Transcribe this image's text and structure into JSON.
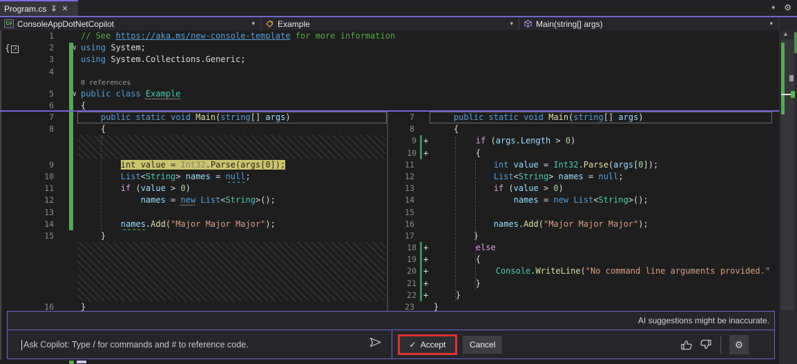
{
  "window": {
    "tab_title": "Program.cs",
    "ai_badge": ""
  },
  "navbar": {
    "items": [
      {
        "icon": "csharp-project-icon",
        "label": "ConsoleAppDotNetCopilot"
      },
      {
        "icon": "class-icon",
        "label": "Example"
      },
      {
        "icon": "method-cube-icon",
        "label": "Main(string[] args)"
      }
    ]
  },
  "colors": {
    "accent_purple": "#7165D2",
    "added_line_green": "#2A6E4F",
    "change_bar_green": "#55A855",
    "highlight_yellow": "#C9C56E",
    "accept_border_red": "#E03131",
    "editor_bg": "#1E1E1E"
  },
  "editor": {
    "codelens": "0 references",
    "top_lines": [
      {
        "n": "1",
        "tok": [
          [
            "// See ",
            "com"
          ],
          [
            "https://aka.ms/new-console-template",
            "link",
            "ul"
          ],
          [
            " for more information",
            "com"
          ]
        ]
      },
      {
        "n": "2",
        "fold": true,
        "tok": [
          [
            "using",
            "kw"
          ],
          [
            " System;",
            "pun"
          ]
        ]
      },
      {
        "n": "3",
        "tok": [
          [
            "using",
            "kw"
          ],
          [
            " System.Collections.Generic;",
            "pun"
          ]
        ]
      },
      {
        "n": "4",
        "tok": []
      },
      {
        "lens": "0 references"
      },
      {
        "n": "5",
        "fold": true,
        "tok": [
          [
            "public",
            "kw"
          ],
          [
            " ",
            "pun"
          ],
          [
            "class",
            "kw"
          ],
          [
            " ",
            "pun"
          ],
          [
            "Example",
            "type",
            "dots"
          ]
        ]
      },
      {
        "n": "6",
        "tok": [
          [
            "{",
            "pun"
          ]
        ]
      }
    ],
    "left_rows": [
      {
        "n": "7",
        "box": true,
        "tok": [
          [
            "    ",
            "pun"
          ],
          [
            "public",
            "kw"
          ],
          [
            " ",
            "pun"
          ],
          [
            "static",
            "kw"
          ],
          [
            " ",
            "pun"
          ],
          [
            "void",
            "kw"
          ],
          [
            " ",
            "pun"
          ],
          [
            "Main",
            "method"
          ],
          [
            "(",
            "pun"
          ],
          [
            "string",
            "kw"
          ],
          [
            "[] ",
            "pun"
          ],
          [
            "args",
            "var"
          ],
          [
            ")",
            "pun"
          ]
        ]
      },
      {
        "n": "8",
        "tok": [
          [
            "    {",
            "pun"
          ]
        ]
      },
      {
        "hatch": true
      },
      {
        "hatch": true
      },
      {
        "n": "9",
        "tok": [
          [
            "        ",
            "pun"
          ],
          [
            "int value = ",
            "dark",
            "hl"
          ],
          [
            "Int32",
            "dim",
            "hl"
          ],
          [
            ".Parse(args[0]);",
            "dark",
            "hl"
          ]
        ]
      },
      {
        "n": "10",
        "tok": [
          [
            "        ",
            "pun"
          ],
          [
            "List",
            "kw"
          ],
          [
            "<",
            "pun"
          ],
          [
            "String",
            "type"
          ],
          [
            "> ",
            "pun"
          ],
          [
            "names",
            "var"
          ],
          [
            " = ",
            "pun"
          ],
          [
            "null",
            "kw",
            "sqt"
          ],
          [
            ";",
            "pun"
          ]
        ]
      },
      {
        "n": "11",
        "tok": [
          [
            "        ",
            "pun"
          ],
          [
            "if",
            "ctrl"
          ],
          [
            " (",
            "pun"
          ],
          [
            "value",
            "var"
          ],
          [
            " > ",
            "pun"
          ],
          [
            "0",
            "num"
          ],
          [
            ")",
            "pun"
          ]
        ]
      },
      {
        "n": "12",
        "tok": [
          [
            "            ",
            "pun"
          ],
          [
            "names",
            "var"
          ],
          [
            " = ",
            "pun"
          ],
          [
            "new",
            "kw",
            "dots"
          ],
          [
            " ",
            "pun"
          ],
          [
            "List",
            "kw"
          ],
          [
            "<",
            "pun"
          ],
          [
            "String",
            "type"
          ],
          [
            ">();",
            "pun"
          ]
        ]
      },
      {
        "n": "13",
        "tok": []
      },
      {
        "n": "14",
        "tok": [
          [
            "        ",
            "pun"
          ],
          [
            "names",
            "var",
            "sqg"
          ],
          [
            ".",
            "pun"
          ],
          [
            "Add",
            "method"
          ],
          [
            "(",
            "pun"
          ],
          [
            "\"Major Major Major\"",
            "str"
          ],
          [
            ");",
            "pun"
          ]
        ]
      },
      {
        "n": "15",
        "tok": [
          [
            "    }",
            "pun"
          ]
        ]
      },
      {
        "hatch": true
      },
      {
        "hatch": true
      },
      {
        "hatch": true
      },
      {
        "hatch": true
      },
      {
        "hatch": true
      },
      {
        "n": "16",
        "tok": [
          [
            "}",
            "pun"
          ]
        ]
      }
    ],
    "right_rows": [
      {
        "n": "7",
        "box": true,
        "tok": [
          [
            "    ",
            "pun"
          ],
          [
            "public",
            "kw"
          ],
          [
            " ",
            "pun"
          ],
          [
            "static",
            "kw"
          ],
          [
            " ",
            "pun"
          ],
          [
            "void",
            "kw"
          ],
          [
            " ",
            "pun"
          ],
          [
            "Main",
            "method"
          ],
          [
            "(",
            "pun"
          ],
          [
            "string",
            "kw"
          ],
          [
            "[] ",
            "pun"
          ],
          [
            "args",
            "var"
          ],
          [
            ")",
            "pun"
          ]
        ]
      },
      {
        "n": "8",
        "tok": [
          [
            "    {",
            "pun"
          ]
        ]
      },
      {
        "n": "9",
        "add": true,
        "tok": [
          [
            "        ",
            "pun"
          ],
          [
            "if",
            "ctrl"
          ],
          [
            " (",
            "pun"
          ],
          [
            "args",
            "var"
          ],
          [
            ".",
            "pun"
          ],
          [
            "Length",
            "var"
          ],
          [
            " > ",
            "pun"
          ],
          [
            "0",
            "num"
          ],
          [
            ")",
            "pun"
          ]
        ]
      },
      {
        "n": "10",
        "add": true,
        "tok": [
          [
            "        {",
            "pun"
          ]
        ]
      },
      {
        "n": "11",
        "tok": [
          [
            "            ",
            "pun"
          ],
          [
            "int",
            "kw"
          ],
          [
            " ",
            "pun"
          ],
          [
            "value",
            "var"
          ],
          [
            " = ",
            "pun"
          ],
          [
            "Int32",
            "type"
          ],
          [
            ".",
            "pun"
          ],
          [
            "Parse",
            "method"
          ],
          [
            "(",
            "pun"
          ],
          [
            "args",
            "var"
          ],
          [
            "[",
            "pun"
          ],
          [
            "0",
            "num"
          ],
          [
            "]);",
            "pun"
          ]
        ]
      },
      {
        "n": "12",
        "tok": [
          [
            "            ",
            "pun"
          ],
          [
            "List",
            "kw"
          ],
          [
            "<",
            "pun"
          ],
          [
            "String",
            "type"
          ],
          [
            "> ",
            "pun"
          ],
          [
            "names",
            "var"
          ],
          [
            " = ",
            "pun"
          ],
          [
            "null",
            "kw"
          ],
          [
            ";",
            "pun"
          ]
        ]
      },
      {
        "n": "13",
        "tok": [
          [
            "            ",
            "pun"
          ],
          [
            "if",
            "ctrl"
          ],
          [
            " (",
            "pun"
          ],
          [
            "value",
            "var"
          ],
          [
            " > ",
            "pun"
          ],
          [
            "0",
            "num"
          ],
          [
            ")",
            "pun"
          ]
        ]
      },
      {
        "n": "14",
        "tok": [
          [
            "                ",
            "pun"
          ],
          [
            "names",
            "var"
          ],
          [
            " = ",
            "pun"
          ],
          [
            "new",
            "kw"
          ],
          [
            " ",
            "pun"
          ],
          [
            "List",
            "kw"
          ],
          [
            "<",
            "pun"
          ],
          [
            "String",
            "type"
          ],
          [
            ">();",
            "pun"
          ]
        ]
      },
      {
        "n": "15",
        "tok": []
      },
      {
        "n": "16",
        "tok": [
          [
            "            ",
            "pun"
          ],
          [
            "names",
            "var"
          ],
          [
            ".",
            "pun"
          ],
          [
            "Add",
            "method"
          ],
          [
            "(",
            "pun"
          ],
          [
            "\"Major Major Major\"",
            "str"
          ],
          [
            ");",
            "pun"
          ]
        ]
      },
      {
        "n": "17",
        "tok": [
          [
            "        }",
            "pun"
          ]
        ]
      },
      {
        "n": "18",
        "add": true,
        "tok": [
          [
            "        ",
            "pun"
          ],
          [
            "else",
            "ctrl"
          ]
        ]
      },
      {
        "n": "19",
        "add": true,
        "tok": [
          [
            "        {",
            "pun"
          ]
        ]
      },
      {
        "n": "20",
        "add": true,
        "tok": [
          [
            "            ",
            "pun"
          ],
          [
            "Console",
            "type"
          ],
          [
            ".",
            "pun"
          ],
          [
            "WriteLine",
            "method"
          ],
          [
            "(",
            "pun"
          ],
          [
            "\"No command line arguments provided.\"",
            "str"
          ]
        ]
      },
      {
        "n": "21",
        "add": true,
        "tok": [
          [
            "        }",
            "pun"
          ]
        ]
      },
      {
        "n": "22",
        "add": true,
        "tok": [
          [
            "    }",
            "pun"
          ]
        ]
      },
      {
        "n": "23",
        "tok": [
          [
            "}",
            "pun"
          ]
        ]
      }
    ]
  },
  "copilot": {
    "disclaimer": "AI suggestions might be inaccurate.",
    "input_placeholder": "Ask Copilot: Type / for commands and # to reference code.",
    "accept_check": "✓",
    "accept_label": "Accept",
    "cancel_label": "Cancel"
  }
}
